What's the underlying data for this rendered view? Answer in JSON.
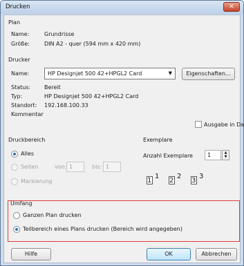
{
  "window": {
    "title": "Drucken"
  },
  "plan": {
    "group_label": "Plan",
    "name_label": "Name:",
    "name_value": "Grundrisse",
    "size_label": "Größe:",
    "size_value": "DIN A2 - quer (594 mm x 420 mm)"
  },
  "printer": {
    "group_label": "Drucker",
    "name_label": "Name:",
    "selected": "HP Designjet 500 42+HPGL2 Card",
    "properties_button": "Eigenschaften...",
    "status_label": "Status:",
    "status_value": "Bereit",
    "type_label": "Typ:",
    "type_value": "HP Designjet 500 42+HPGL2 Card",
    "location_label": "Standort:",
    "location_value": "192.168.100.33",
    "comment_label": "Kommentar",
    "print_to_file_label": "Ausgabe in Datei",
    "print_to_file_checked": false
  },
  "range": {
    "group_label": "Druckbereich",
    "all_label": "Alles",
    "pages_label": "Seiten",
    "from_label": "von:",
    "from_value": "1",
    "to_label": "bis:",
    "to_value": "1",
    "selection_label": "Markierung",
    "selected_option": "Alles"
  },
  "copies": {
    "group_label": "Exemplare",
    "count_label": "Anzahl Exemplare",
    "count_value": "1",
    "collate_digits": [
      "1",
      "1",
      "2",
      "2",
      "3",
      "3"
    ]
  },
  "scope": {
    "group_label": "Umfang",
    "whole_plan_label": "Ganzen Plan drucken",
    "partial_label": "Teilbereich eines Plans drucken (Bereich wird angegeben)",
    "selected_option": "partial",
    "highlight_color": "#e03a3a"
  },
  "footer": {
    "help_button": "Hilfe",
    "ok_button": "OK",
    "cancel_button": "Abbrechen"
  }
}
